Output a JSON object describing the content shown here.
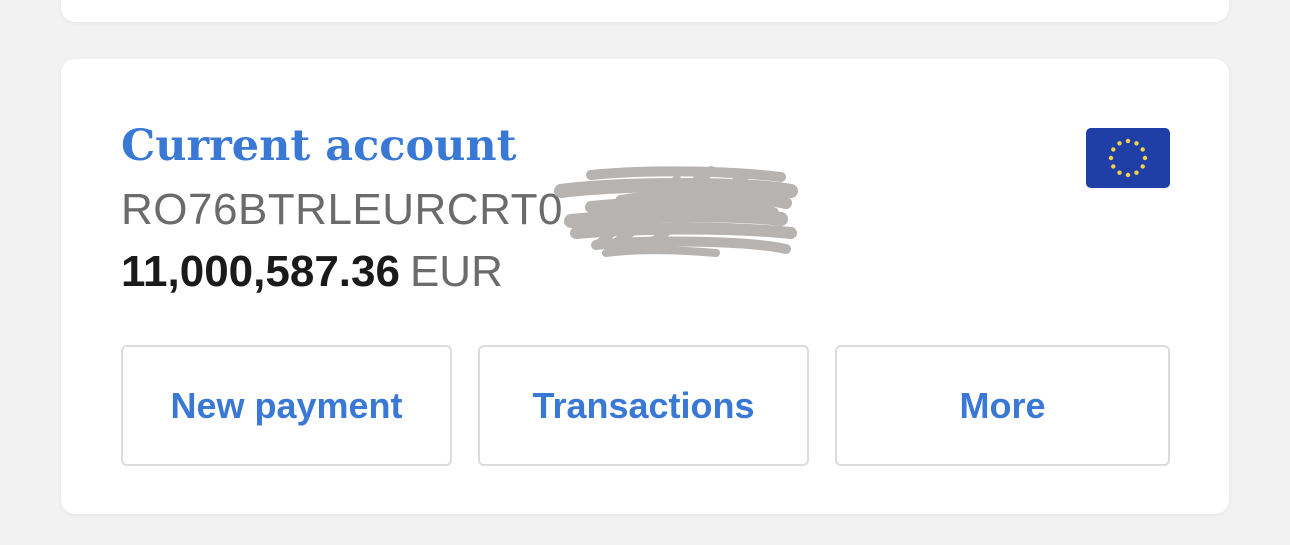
{
  "account": {
    "title": "Current account",
    "iban": "RO76BTRLEURCRT0",
    "balance_amount": "11,000,587.36",
    "currency": "EUR",
    "flag_icon": "eu-flag-icon"
  },
  "actions": {
    "new_payment": "New payment",
    "transactions": "Transactions",
    "more": "More"
  },
  "colors": {
    "accent": "#3a78d6",
    "background": "#f2f2f2",
    "card": "#ffffff",
    "flag_blue": "#1f3fa6",
    "flag_stars": "#f2d34b"
  }
}
